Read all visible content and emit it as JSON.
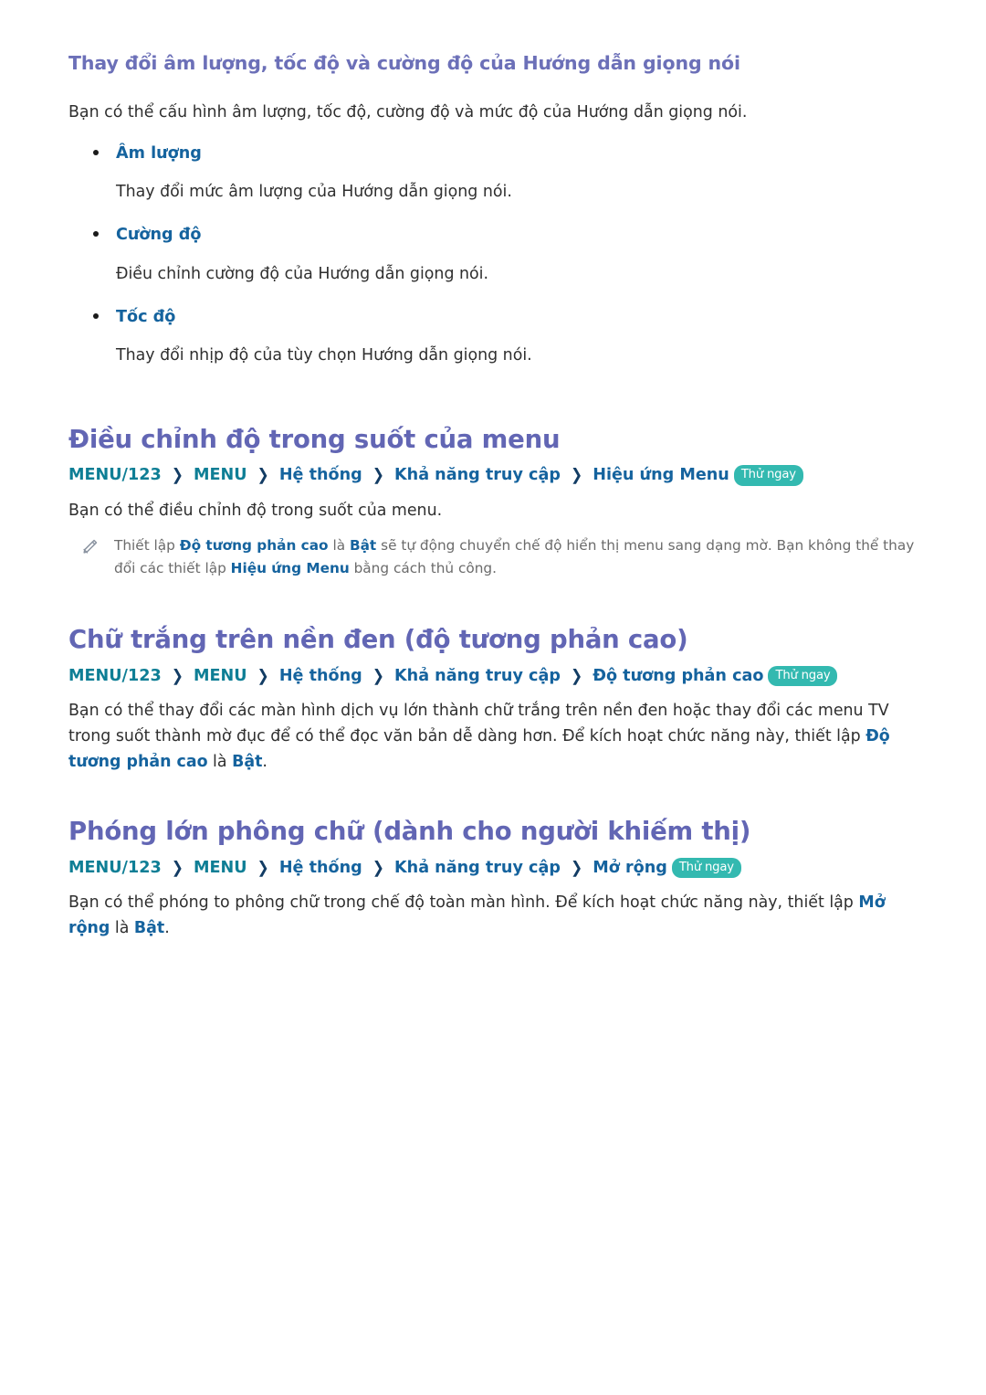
{
  "colors": {
    "heading_purple": "#6266B4",
    "subheading_purple": "#6C70B8",
    "link_blue": "#15639E",
    "menu_teal": "#0E7E95",
    "chevron_navy": "#123C64",
    "badge_teal": "#33B9B0",
    "body_text": "#2f2f2f",
    "note_text": "#6b6b6b"
  },
  "section1": {
    "heading": "Thay đổi âm lượng, tốc độ và cường độ của Hướng dẫn giọng nói",
    "intro": "Bạn có thể cấu hình âm lượng, tốc độ, cường độ và mức độ của Hướng dẫn giọng nói.",
    "bullets": [
      {
        "label": "Âm lượng",
        "desc": "Thay đổi mức âm lượng của Hướng dẫn giọng nói."
      },
      {
        "label": "Cường độ",
        "desc": "Điều chỉnh cường độ của Hướng dẫn giọng nói."
      },
      {
        "label": "Tốc độ",
        "desc": "Thay đổi nhịp độ của tùy chọn Hướng dẫn giọng nói."
      }
    ]
  },
  "section2": {
    "heading": "Điều chỉnh độ trong suốt của menu",
    "path": {
      "crumb1": "MENU/123",
      "crumb2": "MENU",
      "crumb3": "Hệ thống",
      "crumb4": "Khả năng truy cập",
      "crumb5": "Hiệu ứng Menu",
      "chevron": "❯",
      "badge": "Thử ngay"
    },
    "body": "Bạn có thể điều chỉnh độ trong suốt của menu.",
    "note": {
      "icon": "pencil-icon",
      "part1": "Thiết lập ",
      "bold1": "Độ tương phản cao",
      "part2": " là ",
      "bold2": "Bật",
      "part3": " sẽ tự động chuyển chế độ hiển thị menu sang dạng mờ. Bạn không thể thay đổi các thiết lập ",
      "bold3": "Hiệu ứng Menu",
      "part4": " bằng cách thủ công."
    }
  },
  "section3": {
    "heading": "Chữ trắng trên nền đen (độ tương phản cao)",
    "path": {
      "crumb1": "MENU/123",
      "crumb2": "MENU",
      "crumb3": "Hệ thống",
      "crumb4": "Khả năng truy cập",
      "crumb5": "Độ tương phản cao",
      "chevron": "❯",
      "badge": "Thử ngay"
    },
    "body": {
      "part1": "Bạn có thể thay đổi các màn hình dịch vụ lớn thành chữ trắng trên nền đen hoặc thay đổi các menu TV trong suốt thành mờ đục để có thể đọc văn bản dễ dàng hơn. Để kích hoạt chức năng này, thiết lập ",
      "bold1": "Độ tương phản cao",
      "part2": " là ",
      "bold2": "Bật",
      "part3": "."
    }
  },
  "section4": {
    "heading": "Phóng lớn phông chữ (dành cho người khiếm thị)",
    "path": {
      "crumb1": "MENU/123",
      "crumb2": "MENU",
      "crumb3": "Hệ thống",
      "crumb4": "Khả năng truy cập",
      "crumb5": "Mở rộng",
      "chevron": "❯",
      "badge": "Thử ngay"
    },
    "body": {
      "part1": "Bạn có thể phóng to phông chữ trong chế độ toàn màn hình. Để kích hoạt chức năng này, thiết lập ",
      "bold1": "Mở rộng",
      "part2": " là ",
      "bold2": "Bật",
      "part3": "."
    }
  }
}
